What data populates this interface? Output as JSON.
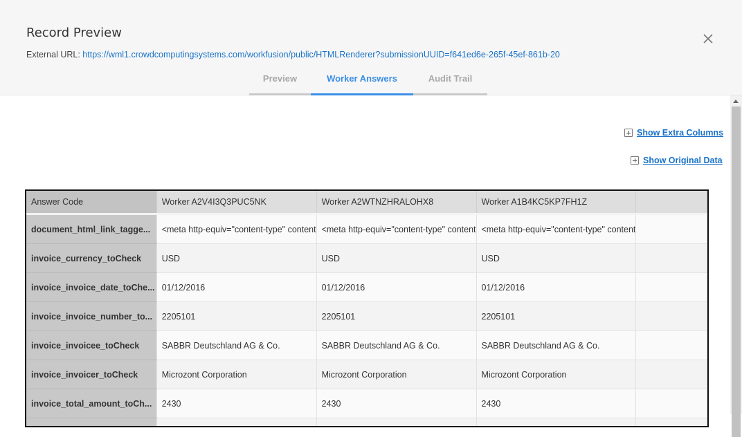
{
  "modal": {
    "title": "Record Preview",
    "external_url_label": "External URL:",
    "external_url": "https://wml1.crowdcomputingsystems.com/workfusion/public/HTMLRenderer?submissionUUID=f641ed6e-265f-45ef-861b-20"
  },
  "tabs": [
    {
      "label": "Preview",
      "active": false
    },
    {
      "label": "Worker Answers",
      "active": true
    },
    {
      "label": "Audit Trail",
      "active": false
    }
  ],
  "actions": {
    "show_extra_columns": "Show Extra Columns",
    "show_original_data": "Show Original Data"
  },
  "table": {
    "headers": [
      "Answer Code",
      "Worker A2V4I3Q3PUC5NK",
      "Worker A2WTNZHRALOHX8",
      "Worker A1B4KC5KP7FH1Z",
      ""
    ],
    "rows": [
      {
        "code": "document_html_link_tagge...",
        "values": [
          "<meta http-equiv=\"content-type\" content",
          "<meta http-equiv=\"content-type\" content",
          "<meta http-equiv=\"content-type\" content",
          ""
        ]
      },
      {
        "code": "invoice_currency_toCheck",
        "values": [
          "USD",
          "USD",
          "USD",
          ""
        ]
      },
      {
        "code": "invoice_invoice_date_toChe...",
        "values": [
          "01/12/2016",
          "01/12/2016",
          "01/12/2016",
          ""
        ]
      },
      {
        "code": "invoice_invoice_number_to...",
        "values": [
          "2205101",
          "2205101",
          "2205101",
          ""
        ]
      },
      {
        "code": "invoice_invoicee_toCheck",
        "values": [
          "SABBR Deutschland AG & Co.",
          "SABBR Deutschland AG & Co.",
          "SABBR Deutschland AG & Co.",
          ""
        ]
      },
      {
        "code": "invoice_invoicer_toCheck",
        "values": [
          "Microzont Corporation",
          "Microzont Corporation",
          "Microzont Corporation",
          ""
        ]
      },
      {
        "code": "invoice_total_amount_toCh...",
        "values": [
          "2430",
          "2430",
          "2430",
          ""
        ]
      },
      {
        "code": "",
        "values": [
          "",
          "",
          "",
          ""
        ]
      }
    ]
  },
  "colors": {
    "accent": "#3a8ee6",
    "link": "#1a73c8",
    "header_bg": "#f6f6f6"
  },
  "icons": {
    "close": "close-icon",
    "expand": "plus-box-icon"
  }
}
